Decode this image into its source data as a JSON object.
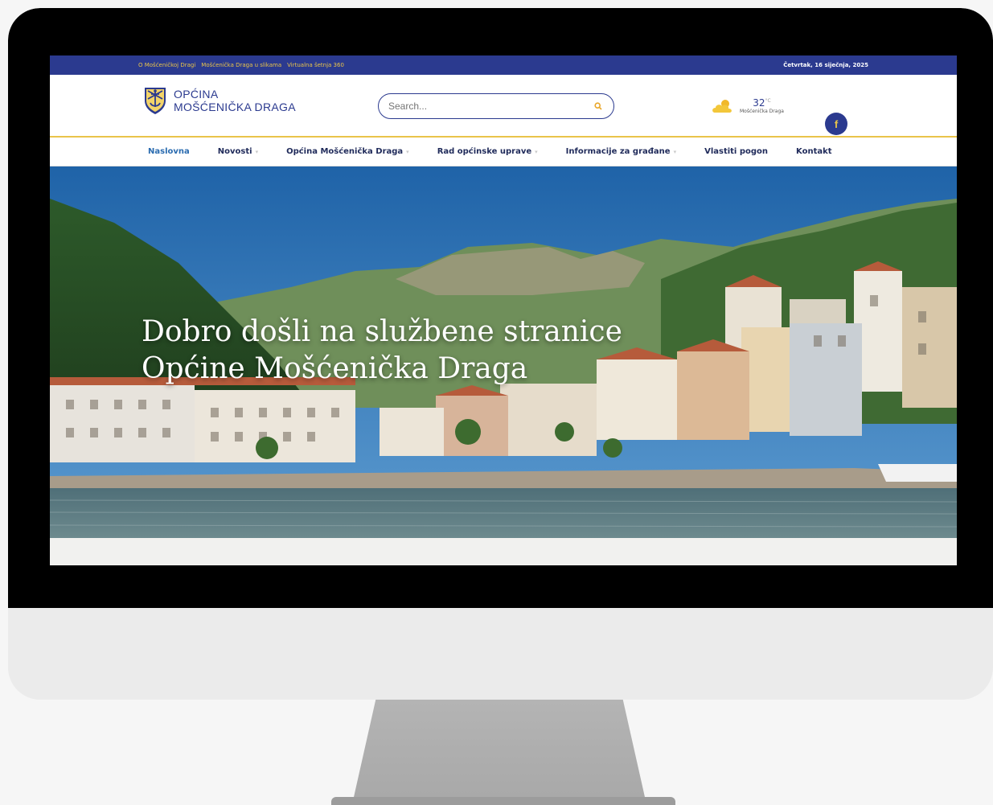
{
  "topbar": {
    "links": [
      "O Mošćeničkoj Dragi",
      "Mošćenička Draga u slikama",
      "Virtualna šetnja 360"
    ],
    "date": "Četvrtak, 16 siječnja, 2025"
  },
  "header": {
    "logo_line1": "OPĆINA",
    "logo_line2": "MOŠĆENIČKA DRAGA",
    "search_placeholder": "Search...",
    "weather_temp": "32",
    "weather_unit": "°C",
    "weather_place": "Mošćenička Draga",
    "facebook_glyph": "f"
  },
  "nav": {
    "items": [
      {
        "label": "Naslovna",
        "dropdown": false
      },
      {
        "label": "Novosti",
        "dropdown": true
      },
      {
        "label": "Općina Mošćenička Draga",
        "dropdown": true
      },
      {
        "label": "Rad općinske uprave",
        "dropdown": true
      },
      {
        "label": "Informacije za građane",
        "dropdown": true
      },
      {
        "label": "Vlastiti pogon",
        "dropdown": false
      },
      {
        "label": "Kontakt",
        "dropdown": false
      }
    ]
  },
  "hero": {
    "title_line1": "Dobro došli na službene stranice",
    "title_line2": "Općine Mošćenička Draga"
  },
  "colors": {
    "brand_blue": "#2b3a8f",
    "brand_yellow": "#e9c44a",
    "nav_active": "#2b6cb0"
  },
  "icons": [
    "shield-logo-icon",
    "search-icon",
    "weather-cloud-icon",
    "facebook-icon",
    "chevron-down-icon"
  ]
}
